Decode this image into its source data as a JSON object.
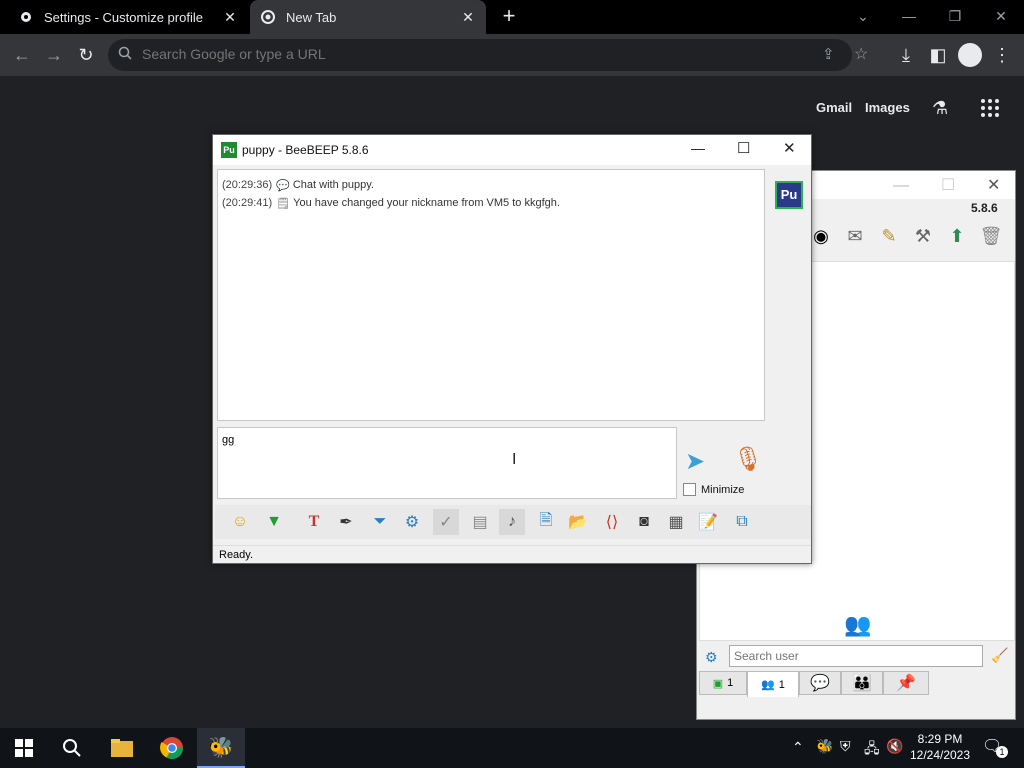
{
  "chrome": {
    "tabs": [
      {
        "title": "Settings - Customize profile",
        "icon": "gear-icon"
      },
      {
        "title": "New Tab",
        "icon": "chrome-icon"
      }
    ],
    "omnibox_placeholder": "Search Google or type a URL",
    "ntp_links": [
      "Gmail",
      "Images"
    ]
  },
  "main_window": {
    "version": "5.8.6",
    "search_placeholder": "Search user",
    "tabs": [
      {
        "icon": "users-online-icon",
        "count": "1"
      },
      {
        "icon": "contacts-icon",
        "count": "1"
      },
      {
        "icon": "chat-icon",
        "count": ""
      },
      {
        "icon": "groups-icon",
        "count": ""
      },
      {
        "icon": "pin-icon",
        "count": ""
      }
    ]
  },
  "chat_window": {
    "title": "puppy - BeeBEEP 5.8.6",
    "avatar": "Pu",
    "log": [
      {
        "time": "(20:29:36)",
        "text": "Chat with puppy."
      },
      {
        "time": "(20:29:41)",
        "text": "You have changed your nickname from VM5 to kkgfgh."
      }
    ],
    "input_value": "gg",
    "minimize_label": "Minimize",
    "status": "Ready."
  },
  "taskbar": {
    "time": "8:29 PM",
    "date": "12/24/2023",
    "notifications": "1"
  }
}
